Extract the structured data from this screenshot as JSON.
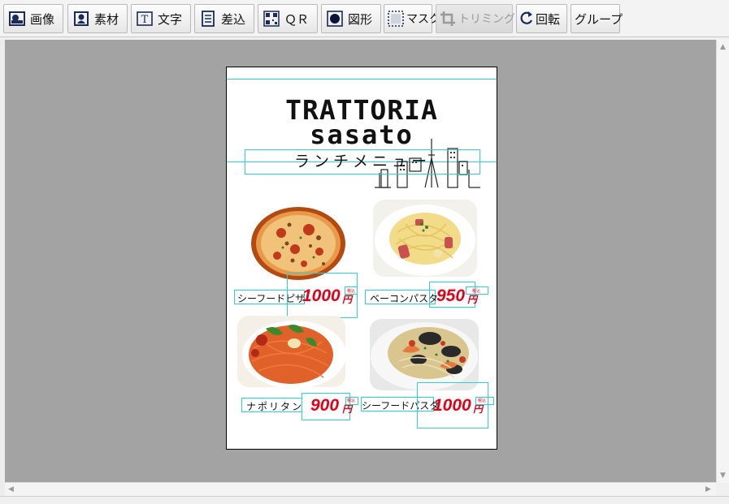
{
  "toolbar": {
    "buttons": [
      {
        "label": "画像",
        "icon": "image-icon"
      },
      {
        "label": "素材",
        "icon": "material-icon"
      },
      {
        "label": "文字",
        "icon": "text-icon"
      },
      {
        "label": "差込",
        "icon": "insert-icon"
      },
      {
        "label": "ＱＲ",
        "icon": "qr-icon"
      },
      {
        "label": "図形",
        "icon": "shape-icon"
      },
      {
        "label": "マスク",
        "icon": "mask-icon"
      },
      {
        "label": "トリミング",
        "icon": "crop-icon",
        "disabled": true
      },
      {
        "label": "回転",
        "icon": "rotate-icon"
      },
      {
        "label": "グループ"
      }
    ]
  },
  "page": {
    "title_line1": "TRATTORIA",
    "title_line2": "sasato",
    "subtitle": "ランチメニュー"
  },
  "menu": [
    {
      "name": "シーフードピザ",
      "price": "1000",
      "yen": "円",
      "tax": "税込"
    },
    {
      "name": "ベーコンパスタ",
      "price": "950",
      "yen": "円",
      "tax": "税込"
    },
    {
      "name": "ナポリタン",
      "price": "900",
      "yen": "円",
      "tax": "税込"
    },
    {
      "name": "シーフードパスタ",
      "price": "1000",
      "yen": "円",
      "tax": "税込"
    }
  ],
  "colors": {
    "price": "#e0001a",
    "guide": "#2fd0d4",
    "workspace": "#a3a3a3"
  }
}
